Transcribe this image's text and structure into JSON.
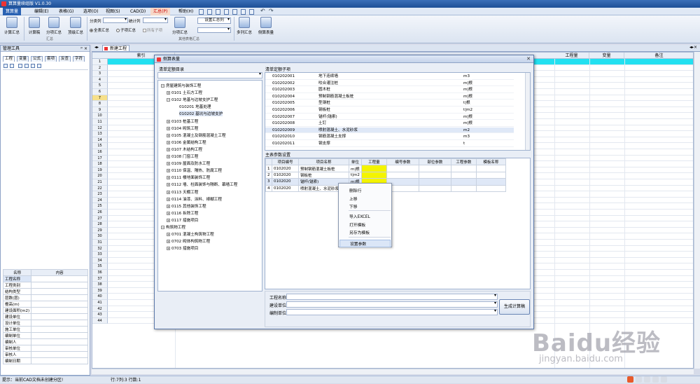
{
  "app": {
    "title": "算算量续组版 V1.0.30"
  },
  "menu": [
    {
      "label": "算算量",
      "active": true
    },
    {
      "label": "编辑(E)"
    },
    {
      "label": "表格(G)"
    },
    {
      "label": "选项(O)"
    },
    {
      "label": "视图(S)"
    },
    {
      "label": "CAD(D)"
    },
    {
      "label": "汇总(P)",
      "highlighted": true
    },
    {
      "label": "帮助(H)"
    }
  ],
  "ribbon": {
    "calc_sum": "计算汇总",
    "calc_draft": "计算稿",
    "part_sum": "分项汇总",
    "top_sum": "顶级汇总",
    "group_sum_label": "汇总",
    "category_label": "分类列",
    "stat_label": "统计列",
    "all_sum": "全表汇总",
    "sub_sum": "子项汇总",
    "all_sub": "所有子项",
    "part_sum2": "分项汇总",
    "set_cols": "设置汇总列",
    "group_other_label": "其他表格汇总",
    "multi_col": "多列汇总",
    "side_table": "侧算表量"
  },
  "left_panel": {
    "title": "管理工具",
    "tabs": [
      "工程",
      "变量",
      "公式",
      "套项",
      "反查",
      "字符"
    ],
    "prop_headers": [
      "名称",
      "内容"
    ],
    "props": [
      "工程名称",
      "工程类别",
      "结构类型",
      "层数(层)",
      "檐高(m)",
      "建设面积(m2)",
      "建设单位",
      "设计单位",
      "施工单位",
      "编制单位",
      "编制人",
      "审核单位",
      "审核人",
      "编制日期"
    ]
  },
  "doc_tab": "新建工程",
  "sheet": {
    "headers": [
      "索引",
      "工程量",
      "变量",
      "备注"
    ],
    "row_count": 44
  },
  "dialog": {
    "title": "侧算表量",
    "catalog_label": "清单定额目录",
    "subitem_label": "清单定额子项",
    "tree": [
      {
        "text": "房屋建筑与装饰工程",
        "level": 0,
        "exp": "⊟"
      },
      {
        "text": "0101 土石方工程",
        "level": 1,
        "exp": "⊞"
      },
      {
        "text": "0102 地基与边坡支护工程",
        "level": 1,
        "exp": "⊟"
      },
      {
        "text": "010201 地基处理",
        "level": 2,
        "exp": ""
      },
      {
        "text": "010202 基坑与边坡支护",
        "level": 2,
        "exp": "",
        "selected": true
      },
      {
        "text": "0103 桩基工程",
        "level": 1,
        "exp": "⊞"
      },
      {
        "text": "0104 砌筑工程",
        "level": 1,
        "exp": "⊞"
      },
      {
        "text": "0105 混凝土及钢筋混凝土工程",
        "level": 1,
        "exp": "⊞"
      },
      {
        "text": "0106 金属结构工程",
        "level": 1,
        "exp": "⊞"
      },
      {
        "text": "0107 木结构工程",
        "level": 1,
        "exp": "⊞"
      },
      {
        "text": "0108 门窗工程",
        "level": 1,
        "exp": "⊞"
      },
      {
        "text": "0109 屋面及防水工程",
        "level": 1,
        "exp": "⊞"
      },
      {
        "text": "0110 保温、隔热、防腐工程",
        "level": 1,
        "exp": "⊞"
      },
      {
        "text": "0111 楼地面装饰工程",
        "level": 1,
        "exp": "⊞"
      },
      {
        "text": "0112 墙、柱面装饰与隔断、幕墙工程",
        "level": 1,
        "exp": "⊞"
      },
      {
        "text": "0113 天棚工程",
        "level": 1,
        "exp": "⊞"
      },
      {
        "text": "0114 油漆、涂料、裱糊工程",
        "level": 1,
        "exp": "⊞"
      },
      {
        "text": "0115 其他装饰工程",
        "level": 1,
        "exp": "⊞"
      },
      {
        "text": "0116 拆除工程",
        "level": 1,
        "exp": "⊞"
      },
      {
        "text": "0117 措施项目",
        "level": 1,
        "exp": "⊞"
      },
      {
        "text": "构筑物工程",
        "level": 0,
        "exp": "⊟"
      },
      {
        "text": "0701 混凝土构筑物工程",
        "level": 1,
        "exp": "⊞"
      },
      {
        "text": "0702 砌体构筑物工程",
        "level": 1,
        "exp": "⊞"
      },
      {
        "text": "0703 措施项目",
        "level": 1,
        "exp": "⊞"
      }
    ],
    "subitems": [
      {
        "code": "010202001",
        "name": "地下连续墙",
        "unit": "m3"
      },
      {
        "code": "010202002",
        "name": "咬合灌注桩",
        "unit": "m|根"
      },
      {
        "code": "010202003",
        "name": "圆木桩",
        "unit": "m|根"
      },
      {
        "code": "010202004",
        "name": "预制钢筋混凝土板桩",
        "unit": "m|根"
      },
      {
        "code": "010202005",
        "name": "型钢桩",
        "unit": "t|根"
      },
      {
        "code": "010202006",
        "name": "钢板桩",
        "unit": "t|m2"
      },
      {
        "code": "010202007",
        "name": "锚杆(锚索)",
        "unit": "m|根"
      },
      {
        "code": "010202008",
        "name": "土钉",
        "unit": "m|根"
      },
      {
        "code": "010202009",
        "name": "喷射混凝土、水泥砂浆",
        "unit": "m2",
        "selected": true
      },
      {
        "code": "010202010",
        "name": "钢筋混凝土支撑",
        "unit": "m3"
      },
      {
        "code": "010202011",
        "name": "钢支撑",
        "unit": "t"
      }
    ],
    "param_label": "主表参数设置",
    "param_headers": [
      "项目编号",
      "项目名称",
      "单位",
      "工程量",
      "编号参数",
      "部位参数",
      "工程参数",
      "模板名称"
    ],
    "params": [
      {
        "no": "1",
        "code": "0102020",
        "name": "预制钢筋混凝土板桩",
        "unit": "m|根"
      },
      {
        "no": "2",
        "code": "0102020",
        "name": "钢板桩",
        "unit": "t|m2"
      },
      {
        "no": "3",
        "code": "0102020",
        "name": "锚杆(锚索)",
        "unit": "m|根",
        "selected": true
      },
      {
        "no": "4",
        "code": "0102020",
        "name": "喷射混凝土、水泥砂浆",
        "unit": ""
      }
    ],
    "context_menu": [
      "删除行",
      "上移",
      "下移",
      "导入EXCEL",
      "打开模板",
      "另存为模板",
      "设置参数"
    ],
    "form": [
      {
        "label": "工程名称",
        "value": ""
      },
      {
        "label": "建设单位",
        "value": ""
      },
      {
        "label": "编制单位",
        "value": ""
      }
    ],
    "generate_btn": "生成计算稿"
  },
  "status": {
    "hint": "提示：当前CAD文档未创建分区!",
    "pos": "行:7列:3 行数:1"
  },
  "watermark": {
    "brand": "Baidu经验",
    "url": "jingyan.baidu.com"
  }
}
